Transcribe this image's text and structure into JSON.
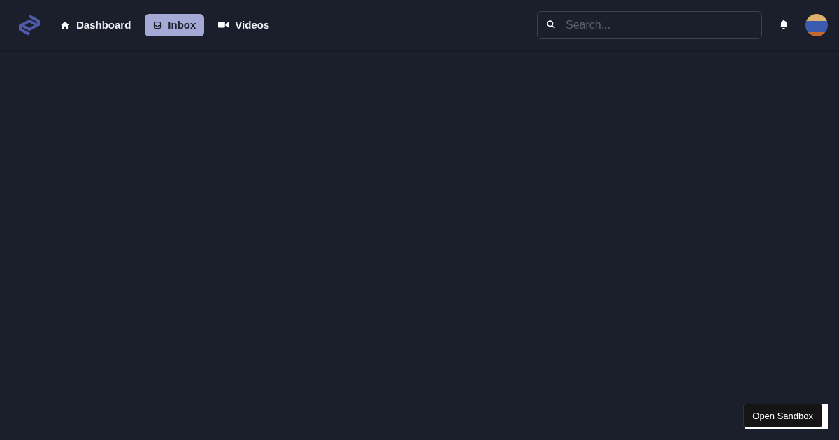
{
  "nav": {
    "items": [
      {
        "label": "Dashboard",
        "selected": false
      },
      {
        "label": "Inbox",
        "selected": true
      },
      {
        "label": "Videos",
        "selected": false
      }
    ]
  },
  "search": {
    "placeholder": "Search..."
  },
  "sandbox_button": "Open Sandbox"
}
